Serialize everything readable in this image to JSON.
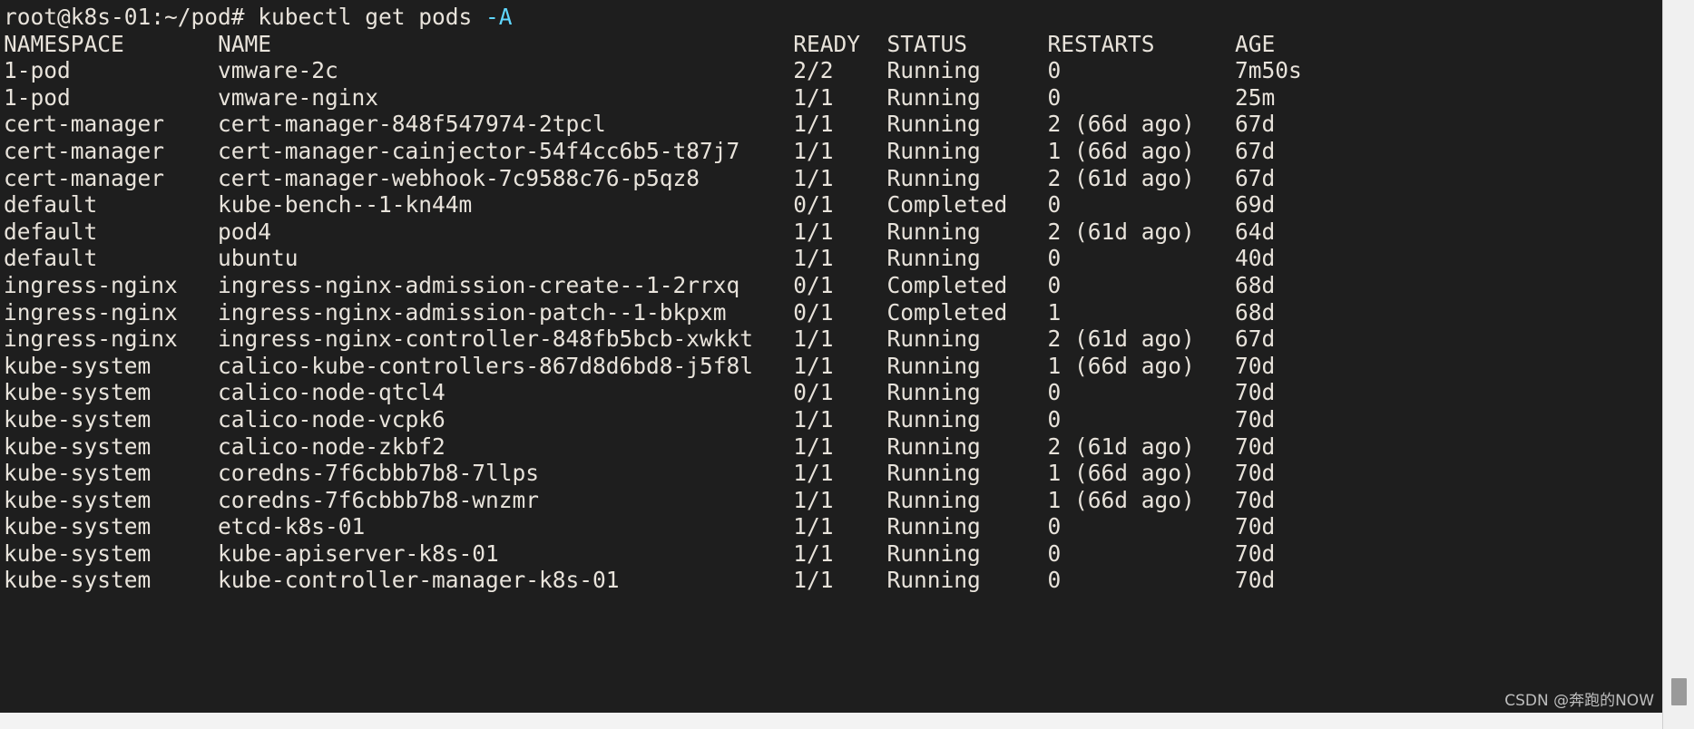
{
  "terminal": {
    "background_color": "#1e1e1e",
    "foreground_color": "#e8e3db",
    "flag_color": "#5fd7ff",
    "prompt": "root@k8s-01:~/pod#",
    "command": "kubectl get pods",
    "command_flag": "-A",
    "prompt_line": "root@k8s-01:~/pod# kubectl get pods "
  },
  "table": {
    "headers": {
      "namespace": "NAMESPACE",
      "name": "NAME",
      "ready": "READY",
      "status": "STATUS",
      "restarts": "RESTARTS",
      "age": "AGE"
    },
    "header_line": "NAMESPACE       NAME                                       READY  STATUS      RESTARTS      AGE",
    "rows": [
      {
        "namespace": "1-pod",
        "name": "vmware-2c",
        "ready": "2/2",
        "status": "Running",
        "restarts": "0",
        "age": "7m50s",
        "line": "1-pod           vmware-2c                                  2/2    Running     0             7m50s"
      },
      {
        "namespace": "1-pod",
        "name": "vmware-nginx",
        "ready": "1/1",
        "status": "Running",
        "restarts": "0",
        "age": "25m",
        "line": "1-pod           vmware-nginx                               1/1    Running     0             25m"
      },
      {
        "namespace": "cert-manager",
        "name": "cert-manager-848f547974-2tpcl",
        "ready": "1/1",
        "status": "Running",
        "restarts": "2 (66d ago)",
        "age": "67d",
        "line": "cert-manager    cert-manager-848f547974-2tpcl              1/1    Running     2 (66d ago)   67d"
      },
      {
        "namespace": "cert-manager",
        "name": "cert-manager-cainjector-54f4cc6b5-t87j7",
        "ready": "1/1",
        "status": "Running",
        "restarts": "1 (66d ago)",
        "age": "67d",
        "line": "cert-manager    cert-manager-cainjector-54f4cc6b5-t87j7    1/1    Running     1 (66d ago)   67d"
      },
      {
        "namespace": "cert-manager",
        "name": "cert-manager-webhook-7c9588c76-p5qz8",
        "ready": "1/1",
        "status": "Running",
        "restarts": "2 (61d ago)",
        "age": "67d",
        "line": "cert-manager    cert-manager-webhook-7c9588c76-p5qz8       1/1    Running     2 (61d ago)   67d"
      },
      {
        "namespace": "default",
        "name": "kube-bench--1-kn44m",
        "ready": "0/1",
        "status": "Completed",
        "restarts": "0",
        "age": "69d",
        "line": "default         kube-bench--1-kn44m                        0/1    Completed   0             69d"
      },
      {
        "namespace": "default",
        "name": "pod4",
        "ready": "1/1",
        "status": "Running",
        "restarts": "2 (61d ago)",
        "age": "64d",
        "line": "default         pod4                                       1/1    Running     2 (61d ago)   64d"
      },
      {
        "namespace": "default",
        "name": "ubuntu",
        "ready": "1/1",
        "status": "Running",
        "restarts": "0",
        "age": "40d",
        "line": "default         ubuntu                                     1/1    Running     0             40d"
      },
      {
        "namespace": "ingress-nginx",
        "name": "ingress-nginx-admission-create--1-2rrxq",
        "ready": "0/1",
        "status": "Completed",
        "restarts": "0",
        "age": "68d",
        "line": "ingress-nginx   ingress-nginx-admission-create--1-2rrxq    0/1    Completed   0             68d"
      },
      {
        "namespace": "ingress-nginx",
        "name": "ingress-nginx-admission-patch--1-bkpxm",
        "ready": "0/1",
        "status": "Completed",
        "restarts": "1",
        "age": "68d",
        "line": "ingress-nginx   ingress-nginx-admission-patch--1-bkpxm     0/1    Completed   1             68d"
      },
      {
        "namespace": "ingress-nginx",
        "name": "ingress-nginx-controller-848fb5bcb-xwkkt",
        "ready": "1/1",
        "status": "Running",
        "restarts": "2 (61d ago)",
        "age": "67d",
        "line": "ingress-nginx   ingress-nginx-controller-848fb5bcb-xwkkt   1/1    Running     2 (61d ago)   67d"
      },
      {
        "namespace": "kube-system",
        "name": "calico-kube-controllers-867d8d6bd8-j5f8l",
        "ready": "1/1",
        "status": "Running",
        "restarts": "1 (66d ago)",
        "age": "70d",
        "line": "kube-system     calico-kube-controllers-867d8d6bd8-j5f8l   1/1    Running     1 (66d ago)   70d"
      },
      {
        "namespace": "kube-system",
        "name": "calico-node-qtcl4",
        "ready": "0/1",
        "status": "Running",
        "restarts": "0",
        "age": "70d",
        "line": "kube-system     calico-node-qtcl4                          0/1    Running     0             70d"
      },
      {
        "namespace": "kube-system",
        "name": "calico-node-vcpk6",
        "ready": "1/1",
        "status": "Running",
        "restarts": "0",
        "age": "70d",
        "line": "kube-system     calico-node-vcpk6                          1/1    Running     0             70d"
      },
      {
        "namespace": "kube-system",
        "name": "calico-node-zkbf2",
        "ready": "1/1",
        "status": "Running",
        "restarts": "2 (61d ago)",
        "age": "70d",
        "line": "kube-system     calico-node-zkbf2                          1/1    Running     2 (61d ago)   70d"
      },
      {
        "namespace": "kube-system",
        "name": "coredns-7f6cbbb7b8-7llps",
        "ready": "1/1",
        "status": "Running",
        "restarts": "1 (66d ago)",
        "age": "70d",
        "line": "kube-system     coredns-7f6cbbb7b8-7llps                   1/1    Running     1 (66d ago)   70d"
      },
      {
        "namespace": "kube-system",
        "name": "coredns-7f6cbbb7b8-wnzmr",
        "ready": "1/1",
        "status": "Running",
        "restarts": "1 (66d ago)",
        "age": "70d",
        "line": "kube-system     coredns-7f6cbbb7b8-wnzmr                   1/1    Running     1 (66d ago)   70d"
      },
      {
        "namespace": "kube-system",
        "name": "etcd-k8s-01",
        "ready": "1/1",
        "status": "Running",
        "restarts": "0",
        "age": "70d",
        "line": "kube-system     etcd-k8s-01                                1/1    Running     0             70d"
      },
      {
        "namespace": "kube-system",
        "name": "kube-apiserver-k8s-01",
        "ready": "1/1",
        "status": "Running",
        "restarts": "0",
        "age": "70d",
        "line": "kube-system     kube-apiserver-k8s-01                      1/1    Running     0             70d"
      },
      {
        "namespace": "kube-system",
        "name": "kube-controller-manager-k8s-01",
        "ready": "1/1",
        "status": "Running",
        "restarts": "0",
        "age": "70d",
        "line": "kube-system     kube-controller-manager-k8s-01             1/1    Running     0             70d"
      }
    ]
  },
  "watermark": {
    "text": "CSDN @奔跑的NOW"
  }
}
